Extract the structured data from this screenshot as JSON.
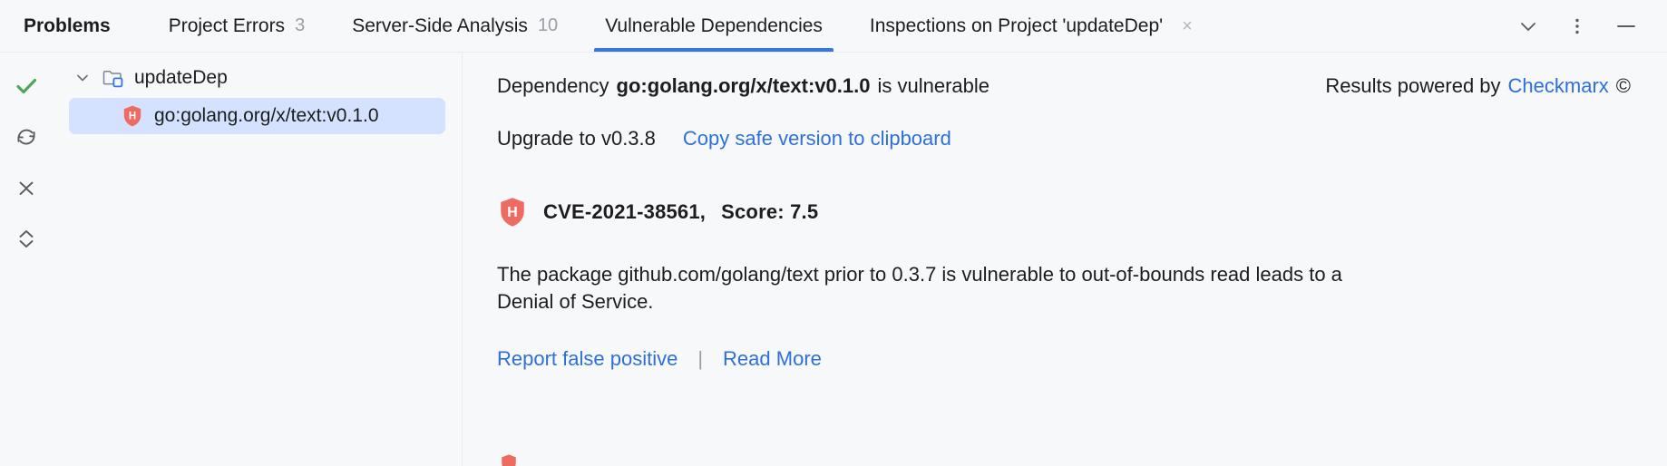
{
  "window": {
    "title": "Problems"
  },
  "tabs": [
    {
      "label": "Problems",
      "count": "",
      "active": false,
      "closable": false
    },
    {
      "label": "Project Errors",
      "count": "3",
      "active": false,
      "closable": false
    },
    {
      "label": "Server-Side Analysis",
      "count": "10",
      "active": false,
      "closable": false
    },
    {
      "label": "Vulnerable Dependencies",
      "count": "",
      "active": true,
      "closable": false
    },
    {
      "label": "Inspections on Project 'updateDep'",
      "count": "",
      "active": false,
      "closable": true
    }
  ],
  "tab_close_glyph": "×",
  "tabbar_actions": [
    {
      "name": "chevron-down-icon",
      "tooltip": "Show Options"
    },
    {
      "name": "more-options-icon",
      "tooltip": "More Options"
    },
    {
      "name": "minimize-icon",
      "tooltip": "Hide"
    }
  ],
  "left_toolbar": [
    {
      "name": "checkmark-icon",
      "tooltip": "Inspection Done"
    },
    {
      "name": "rescan-icon",
      "tooltip": "Rescan"
    },
    {
      "name": "collapse-all-icon",
      "tooltip": "Collapse All"
    },
    {
      "name": "expand-all-icon",
      "tooltip": "Expand All"
    }
  ],
  "tree": {
    "root": {
      "label": "updateDep",
      "expanded": true,
      "icon": "module-folder-icon"
    },
    "children": [
      {
        "label": "go:golang.org/x/text:v0.1.0",
        "icon": "high-severity-shield-icon",
        "severity_letter": "H",
        "selected": true
      }
    ]
  },
  "detail": {
    "dependency_prefix": "Dependency",
    "dependency_name": "go:golang.org/x/text:v0.1.0",
    "dependency_suffix": "is vulnerable",
    "powered_prefix": "Results powered by",
    "powered_link": "Checkmarx",
    "powered_suffix": "©",
    "upgrade_label": "Upgrade to v0.3.8",
    "copy_link": "Copy safe version to clipboard",
    "cve_id": "CVE-2021-38561,",
    "cve_score_label": "Score: 7.5",
    "severity_letter": "H",
    "description": "The package github.com/golang/text prior to 0.3.7 is vulnerable to out-of-bounds read leads to a Denial of Service.",
    "report_link": "Report false positive",
    "separator": "|",
    "read_more_link": "Read More"
  },
  "colors": {
    "accent": "#3574F0",
    "link": "#2E6FD9",
    "severity_high": "#EE6B62",
    "selection": "#D4E2FF",
    "background": "#F7F8FA",
    "border": "#EBECF0",
    "muted_text": "#9A9FA7",
    "checkmark_green": "#4CA758"
  }
}
